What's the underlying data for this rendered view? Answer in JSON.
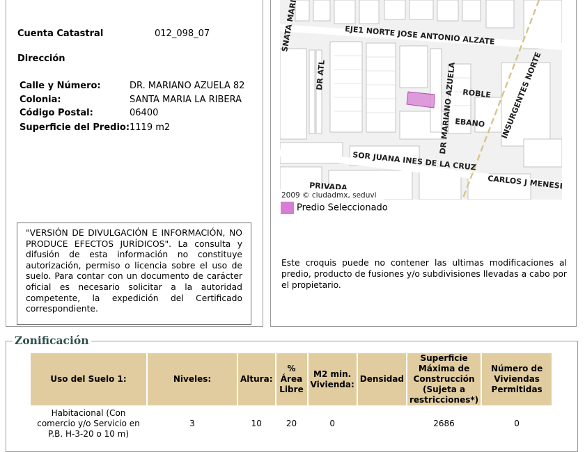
{
  "cuenta": {
    "label": "Cuenta Catastral",
    "value": "012_098_07"
  },
  "direccion_title": "Dirección",
  "address": [
    {
      "label": "Calle y Número:",
      "value": "DR. MARIANO AZUELA 82"
    },
    {
      "label": "Colonia:",
      "value": "SANTA MARIA LA RIBERA"
    },
    {
      "label": "Código Postal:",
      "value": "06400"
    },
    {
      "label": "Superficie del Predio:",
      "value": "1119 m2"
    }
  ],
  "notice": "\"VERSIÓN DE DIVULGACIÓN E INFORMACIÓN, NO PRODUCE EFECTOS JURÍDICOS\". La consulta y difusión de esta información no constituye autorización, permiso o licencia sobre el uso de suelo. Para contar con un documento de carácter oficial es necesario solicitar a la autoridad competente, la expedición del Certificado correspondiente.",
  "map": {
    "streets": {
      "eje1": "EJE1 NORTE JOSE ANTONIO ALZATE",
      "snata_maria": "SNATA MARIA",
      "dr_atl": "DR ATL",
      "dr_mariano_azuela": "DR MARIANO AZUELA",
      "roble": "ROBLE",
      "ebano": "EBANO",
      "insurgentes": "INSURGENTES NORTE",
      "sor_juana": "SOR JUANA INES DE LA CRUZ",
      "carlos": "CARLOS J MENESES",
      "privada": "PRIVADA"
    },
    "credit": "2009 © ciudadmx, seduvi",
    "highlight_color": "#d77dd3"
  },
  "legend": {
    "label": "Predio Seleccionado",
    "color": "#d77dd3"
  },
  "disclaimer": "Este croquis puede no contener las ultimas modificaciones al predio, producto de fusiones y/o subdivisiones llevadas a cabo por el propietario.",
  "zonificacion": {
    "title": "Zonificación",
    "headers": [
      "Uso del Suelo 1:",
      "Niveles:",
      "Altura:",
      "% Área Libre",
      "M2 min. Vivienda:",
      "Densidad",
      "Superficie Máxima de Construcción (Sujeta a restricciones*)",
      "Número de Viviendas Permitidas"
    ],
    "row": [
      "Habitacional (Con comercio y/o Servicio en P.B. H-3-20 o 10 m)",
      "3",
      "10",
      "20",
      "0",
      "",
      "2686",
      "0"
    ]
  }
}
